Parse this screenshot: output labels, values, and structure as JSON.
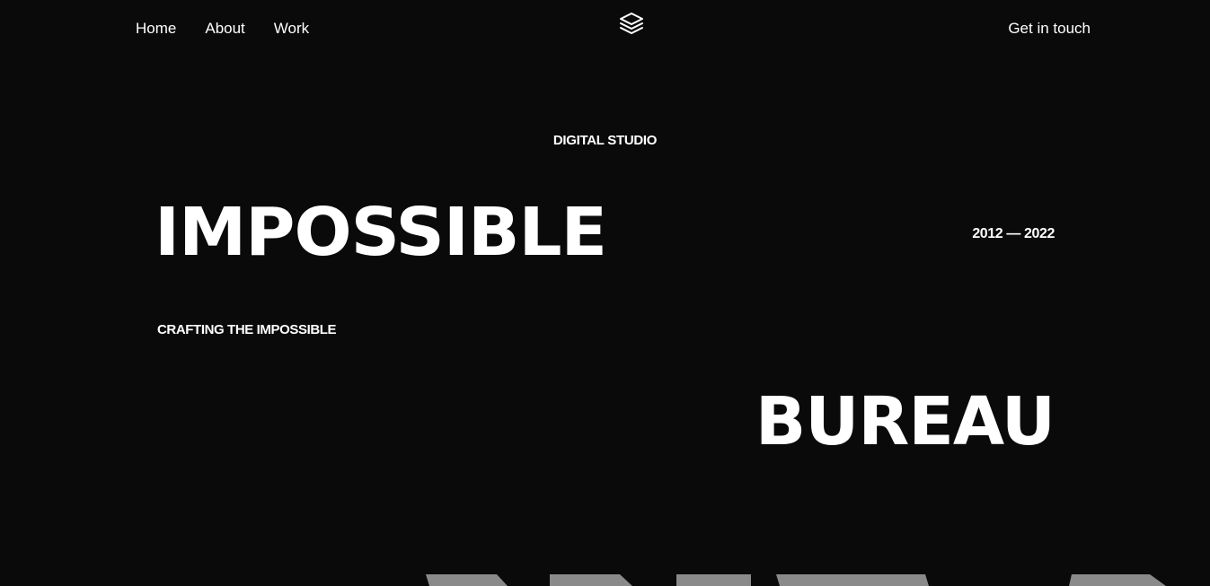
{
  "nav": {
    "links": [
      {
        "label": "Home"
      },
      {
        "label": "About"
      },
      {
        "label": "Work"
      }
    ],
    "logo_icon": "stacked-layers-icon",
    "cta_label": "Get in touch"
  },
  "hero": {
    "eyebrow": "DIGITAL STUDIO",
    "headline_1": "IMPOSSIBLE",
    "years": "2012 — 2022",
    "tagline": "CRAFTING THE IMPOSSIBLE",
    "headline_2": "BUREAU"
  },
  "colors": {
    "background": "#0a0a0a",
    "text": "#ffffff",
    "accent_gray": "#8a8a8a"
  }
}
